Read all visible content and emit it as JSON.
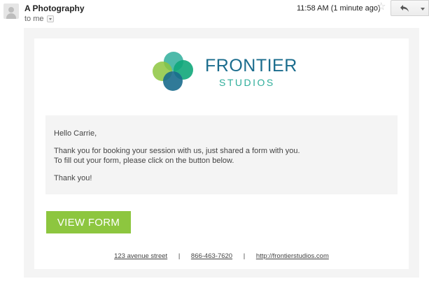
{
  "header": {
    "sender": "A Photography",
    "recipient_label": "to me",
    "timestamp": "11:58 AM (1 minute ago)",
    "star_icon": "star-outline-icon",
    "reply_icon": "reply-arrow-icon"
  },
  "logo": {
    "name": "FRONTIER",
    "tagline": "STUDIOS",
    "colors": {
      "teal": "#2fae9b",
      "blue": "#1a6c8d",
      "green": "#8dc63f"
    }
  },
  "message": {
    "greeting": "Hello Carrie,",
    "line1": "Thank you for booking your session with us, just shared a form with you.",
    "line2": "To fill out your form, please click on the button below.",
    "closing": "Thank you!"
  },
  "cta": {
    "label": "VIEW FORM",
    "color": "#8dc63f"
  },
  "footer": {
    "address": "123 avenue street",
    "separator": "|",
    "phone": "866-463-7620",
    "website": "http://frontierstudios.com"
  }
}
